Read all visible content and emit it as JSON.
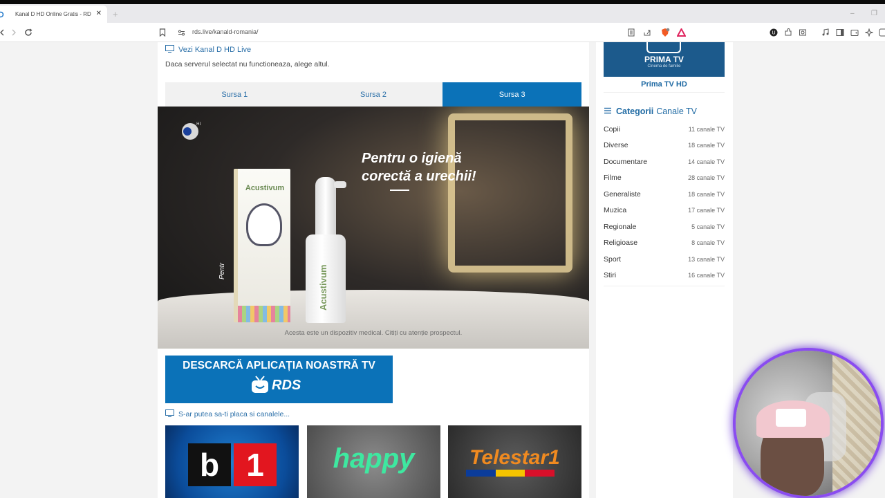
{
  "browser": {
    "tab_title": "Kanal D HD Online Gratis - RD",
    "tab_close": "✕",
    "new_tab": "+",
    "url": "rds.live/kanald-romania/",
    "min": "–",
    "max": "❐"
  },
  "main": {
    "live_title": "Vezi Kanal D HD Live",
    "notice": "Daca serverul selectat nu functioneaza, alege altul.",
    "sources": [
      {
        "label": "Sursa 1",
        "active": false
      },
      {
        "label": "Sursa 2",
        "active": false
      },
      {
        "label": "Sursa 3",
        "active": true
      }
    ],
    "player": {
      "headline_line1": "Pentru o igienă",
      "headline_line2": "corectă a urechii!",
      "product_brand": "Acustivum",
      "side_text": "Pentr",
      "disclaimer": "Acesta este un dispozitiv medical. Citiți cu atenție prospectul."
    },
    "app_banner": {
      "title": "DESCARCĂ APLICAȚIA NOASTRĂ TV",
      "logo_text": "RDS"
    },
    "suggest_title": "S-ar putea sa-ti placa si canalele...",
    "thumbnails": {
      "b1_b": "b",
      "b1_one": "1",
      "happy": "happy",
      "telestar": "Telestar1"
    }
  },
  "sidebar": {
    "prima_logo": "PRIMA TV",
    "prima_sub": "Cinema de familie",
    "prima_label": "Prima TV HD",
    "categories_title_1": "Categorii",
    "categories_title_2": "Canale TV",
    "categories": [
      {
        "name": "Copii",
        "count": "11 canale TV"
      },
      {
        "name": "Diverse",
        "count": "18 canale TV"
      },
      {
        "name": "Documentare",
        "count": "14 canale TV"
      },
      {
        "name": "Filme",
        "count": "28 canale TV"
      },
      {
        "name": "Generaliste",
        "count": "18 canale TV"
      },
      {
        "name": "Muzica",
        "count": "17 canale TV"
      },
      {
        "name": "Regionale",
        "count": "5 canale TV"
      },
      {
        "name": "Religioase",
        "count": "8 canale TV"
      },
      {
        "name": "Sport",
        "count": "13 canale TV"
      },
      {
        "name": "Stiri",
        "count": "16 canale TV"
      }
    ]
  },
  "colors": {
    "accent": "#0b72b8",
    "link": "#2a6fa8",
    "webcam_ring": "#8a4cf0"
  }
}
